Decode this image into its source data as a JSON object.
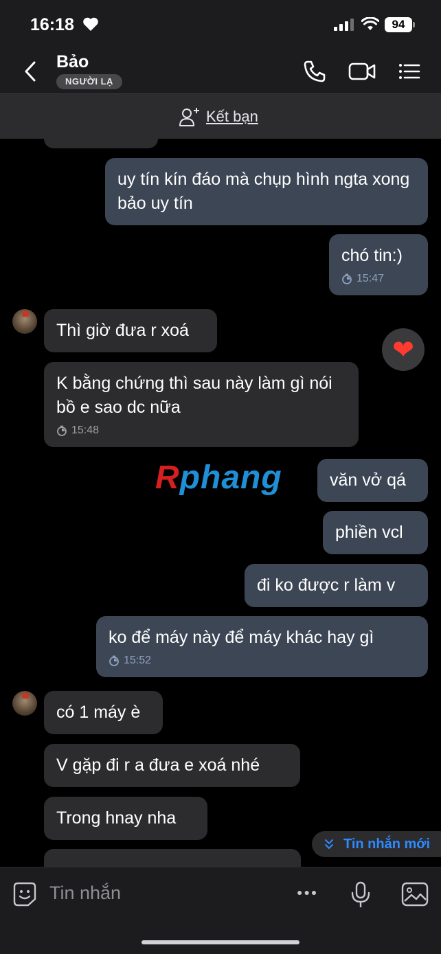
{
  "status_bar": {
    "time": "16:18",
    "battery": "94"
  },
  "header": {
    "contact_name": "Bảo",
    "badge": "NGƯỜI LẠ"
  },
  "add_friend": {
    "label": "Kết bạn"
  },
  "messages": {
    "m1": "uy tín kín đáo mà chụp hình ngta xong bảo uy tín",
    "m2": "chó tin:)",
    "m2_time": "15:47",
    "m3": "Thì giờ đưa r xoá",
    "m4": "K bằng chứng thì sau này làm gì nói bồ e sao dc nữa",
    "m4_time": "15:48",
    "m5": "văn vở qá",
    "m6": "phiền vcl",
    "m7": "đi ko được r làm v",
    "m8": "ko để máy này để máy khác hay gì",
    "m8_time": "15:52",
    "m9": "có 1 máy è",
    "m10": "V gặp đi r a đưa e xoá nhé",
    "m11": "Trong hnay nha"
  },
  "reaction": "❤",
  "watermark": {
    "first": "R",
    "rest": "phang"
  },
  "new_messages": {
    "label": "Tin nhắn mới"
  },
  "composer": {
    "placeholder": "Tin nhắn",
    "more": "●●●"
  }
}
